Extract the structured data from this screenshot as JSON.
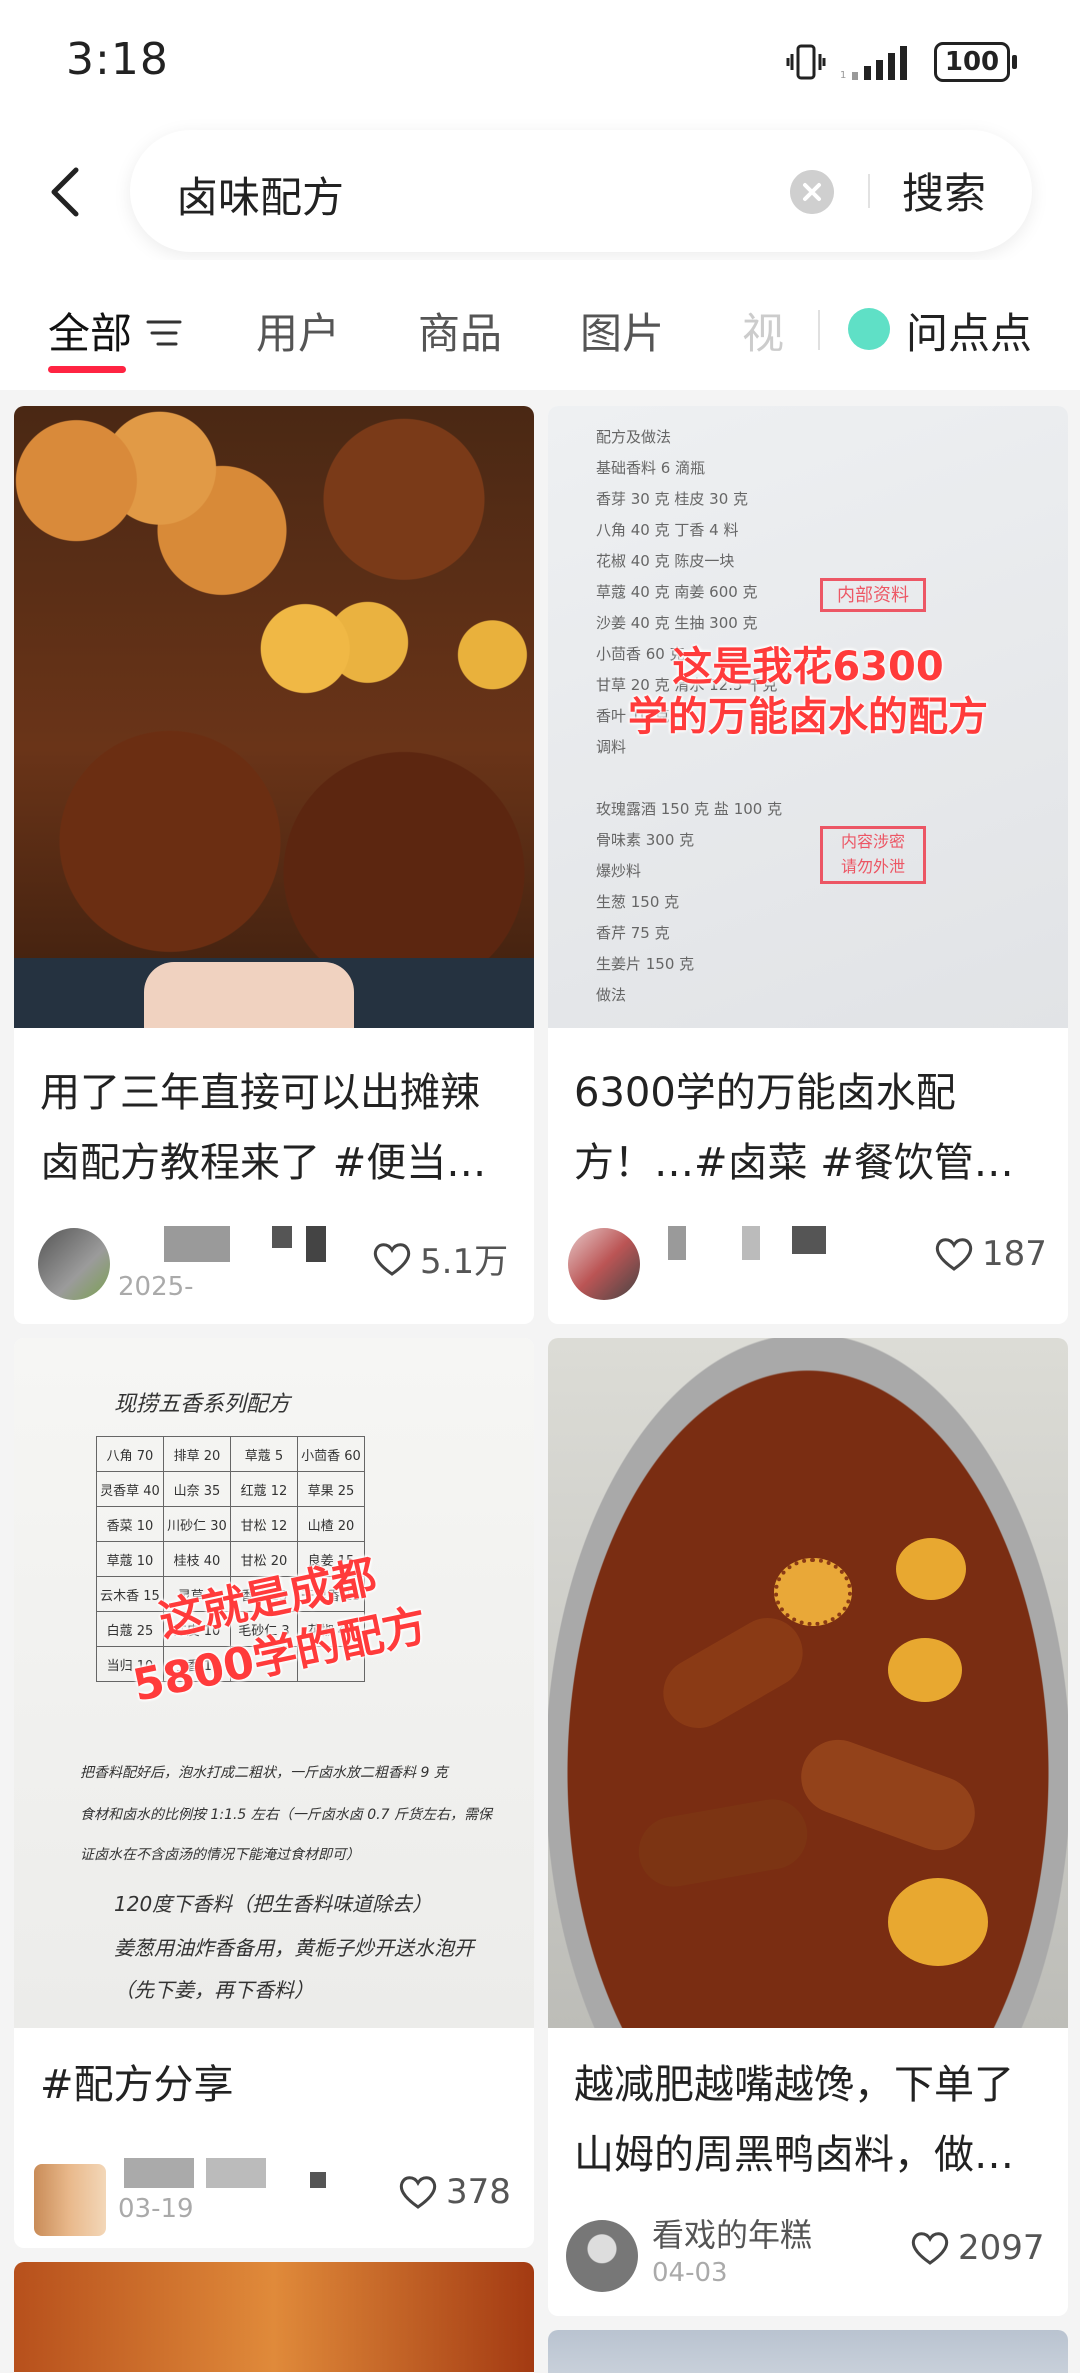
{
  "status_bar": {
    "time": "3:18",
    "battery": "100"
  },
  "search": {
    "query": "卤味配方",
    "submit_label": "搜索"
  },
  "tabs": {
    "items": [
      {
        "label": "全部",
        "active": true
      },
      {
        "label": "用户"
      },
      {
        "label": "商品"
      },
      {
        "label": "图片"
      },
      {
        "label": "视"
      }
    ],
    "ask_label": "问点点"
  },
  "feed": [
    {
      "title": "用了三年直接可以出摊辣卤配方教程来了 #便当…",
      "date": "2025-",
      "likes": "5.1万"
    },
    {
      "title": "6300学的万能卤水配方！…#卤菜 #餐饮管…",
      "overlay": "这是我花6300\n学的万能卤水的配方",
      "likes": "187"
    },
    {
      "title": "#配方分享",
      "overlay": "这就是成都\n5800学的配方",
      "date": "03-19",
      "likes": "378"
    },
    {
      "title": "越减肥越嘴越馋，下单了山姆的周黑鸭卤料，做…",
      "author": "看戏的年糕",
      "date": "04-03",
      "likes": "2097"
    }
  ],
  "paper": {
    "lines": [
      "配方及做法",
      "基础香料 6 滴瓶",
      "香芽 30 克          桂皮 30 克",
      "八角 40 克          丁香 4 料",
      "花椒 40 克          陈皮一块",
      "草蔻 40 克          南姜 600 克",
      "沙姜 40 克          生抽 300 克",
      "小茴香 60 克",
      "甘草 20 克          清水 12.5 千克",
      "香叶 10 克",
      "调料",
      "",
      "玫瑰露酒 150 克      盐 100 克",
      "骨味素 300 克",
      "爆炒料",
      "生葱 150 克",
      "香芹 75 克",
      "生姜片 150 克",
      "做法"
    ],
    "stamp_top": "内部资料",
    "stamp_bottom": "内容涉密\n请勿外泄"
  },
  "table": {
    "title": "现捞五香系列配方",
    "rows": [
      [
        "八角 70",
        "排草 20",
        "草蔻 5",
        "小茴香 60"
      ],
      [
        "灵香草 40",
        "山奈 35",
        "红蔻 12",
        "草果 25"
      ],
      [
        "香菜 10",
        "川砂仁 30",
        "甘松 12",
        "山楂 20"
      ],
      [
        "草蔻 10",
        "桂枝 40",
        "甘松 20",
        "良姜 15"
      ],
      [
        "云木香 15",
        "灵草 5",
        "香砂 13",
        "干里香 15"
      ],
      [
        "白蔻 25",
        "陈皮 10",
        "毛砂仁 3",
        "花椒 45"
      ],
      [
        "当归 10",
        "丁香 10",
        "",
        ""
      ]
    ],
    "notes": [
      "把香料配好后，泡水打成二粗状，一斤卤水放二粗香料 9 克",
      "食材和卤水的比例按 1:1.5 左右（一斤卤水卤 0.7 斤货左右，需保",
      "证卤水在不含卤汤的情况下能淹过食材即可）",
      "120度下香料（把生香料味道除去）",
      "姜葱用油炸香备用，黄栀子炒开送水泡开",
      "（先下姜，再下香料）"
    ]
  },
  "colors": {
    "accent": "#ff2442",
    "overlay_red": "#ff3b3b",
    "ask_dot": "#5fe0c6"
  }
}
